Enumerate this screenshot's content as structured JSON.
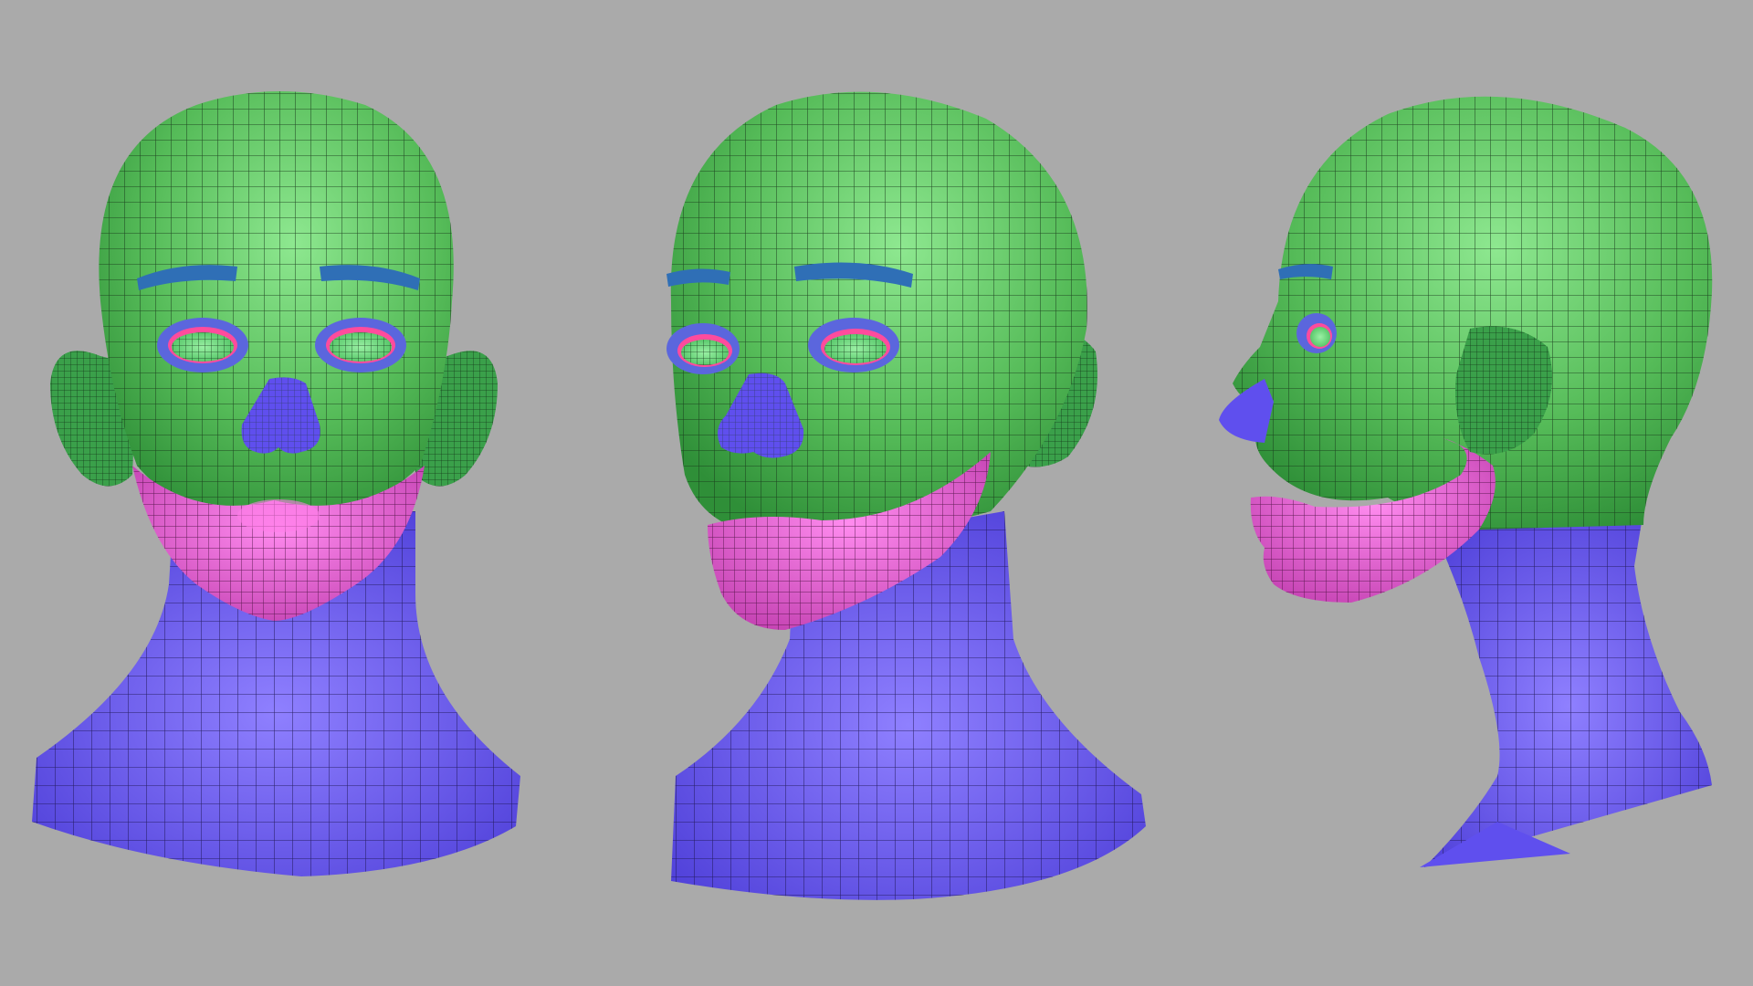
{
  "scene": {
    "background": "#aaaaaa",
    "views": [
      {
        "name": "front"
      },
      {
        "name": "three-quarter"
      },
      {
        "name": "side"
      }
    ]
  },
  "colors": {
    "scalp_face": "#47b04f",
    "scalp_highlight": "#8ee890",
    "jaw_lips": "#e24fcf",
    "jaw_highlight": "#ff8cef",
    "neck_nose": "#5f4fee",
    "neck_highlight": "#8f80ff",
    "eyebrow": "#2f6fb6",
    "eye_socket": "#5b66dd",
    "eye_inner": "#79e28a",
    "eyelid_rim": "#ff4b9d",
    "ear": "#3aa04a",
    "wire": "#1a2a1a"
  }
}
